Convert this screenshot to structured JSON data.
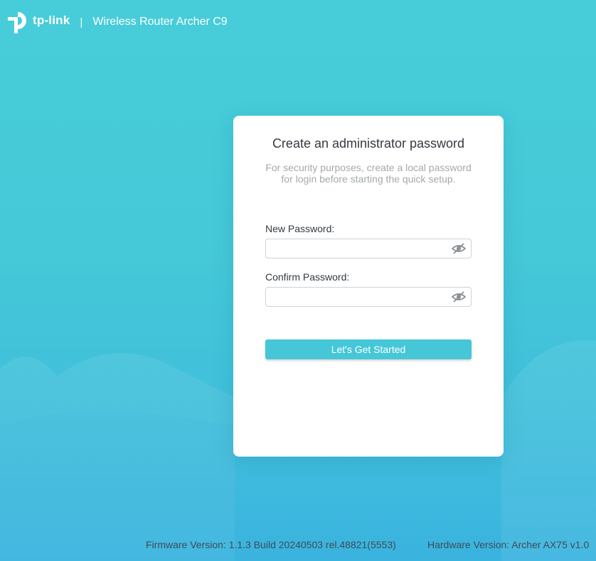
{
  "header": {
    "logo_icon": "tp-link-logo-icon",
    "logo_text": "tp-link",
    "separator": "|",
    "title": "Wireless Router Archer C9"
  },
  "card": {
    "title": "Create an administrator password",
    "subtitle_line1": "For security purposes, create a local password",
    "subtitle_line2": "for login before starting the quick setup.",
    "new_password": {
      "label": "New Password:",
      "value": "",
      "placeholder": "",
      "toggle_icon": "eye-slash-icon"
    },
    "confirm_password": {
      "label": "Confirm Password:",
      "value": "",
      "placeholder": "",
      "toggle_icon": "eye-slash-icon"
    },
    "submit_label": "Let's Get Started"
  },
  "footer": {
    "firmware": "Firmware Version: 1.1.3 Build 20240503 rel.48821(5553)",
    "hardware": "Hardware Version: Archer AX75 v1.0"
  },
  "colors": {
    "background": "#45c8d8",
    "accent": "#45c7d8",
    "card": "#ffffff",
    "title_text": "#333a40",
    "muted_text": "#a4a9ad"
  }
}
